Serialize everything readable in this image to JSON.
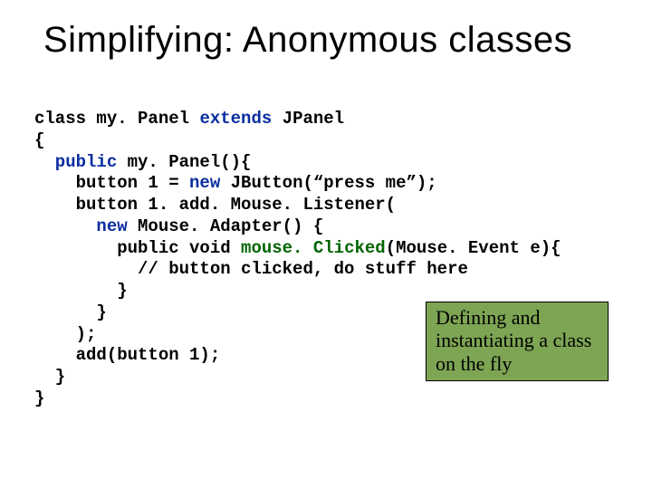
{
  "title": "Simplifying: Anonymous classes",
  "code": {
    "l1a": "class my. Panel ",
    "l1b": "extends",
    "l1c": " JPanel",
    "l2": "{",
    "l3a": "  public",
    "l3b": " my. Panel(){",
    "l4a": "    button 1 = ",
    "l4b": "new",
    "l4c": " JButton(“press me”);",
    "l5": "    button 1. add. Mouse. Listener(",
    "l6a": "      new",
    "l6b": " Mouse. Adapter() {",
    "l7a": "        public void ",
    "l7b": "mouse. Clicked",
    "l7c": "(Mouse. Event e){",
    "l8": "          // button clicked, do stuff here",
    "l9": "        }",
    "l10": "      }",
    "l11": "    );",
    "l12": "    add(button 1);",
    "l13": "  }",
    "l14": "}"
  },
  "callout": "Defining and instantiating a class on the fly"
}
